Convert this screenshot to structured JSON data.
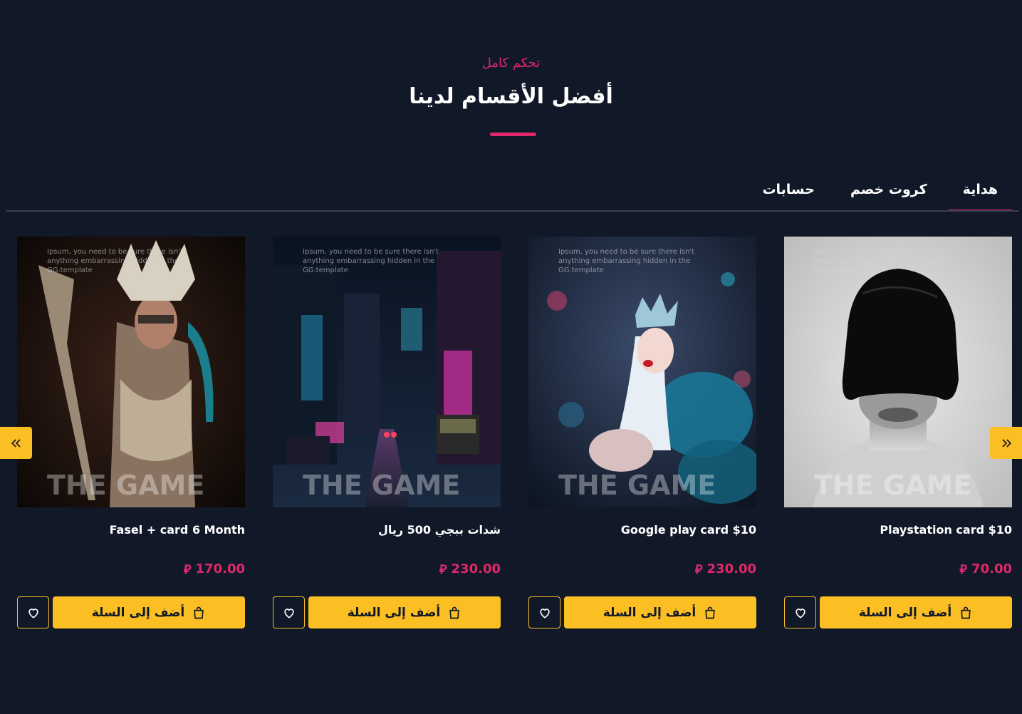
{
  "header": {
    "subtitle": "تحكم كامل",
    "title": "أفضل الأقسام لدينا"
  },
  "tabs": [
    {
      "label": "هداية",
      "active": true
    },
    {
      "label": "كروت خصم",
      "active": false
    },
    {
      "label": "حسابات",
      "active": false
    }
  ],
  "products": [
    {
      "name": "Playstation card $10",
      "price": "70.00",
      "add_label": "أضف إلى السلة",
      "image": "masked-face-portrait"
    },
    {
      "name": "Google play card $10",
      "price": "230.00",
      "add_label": "أضف إلى السلة",
      "image": "crowned-woman-portrait"
    },
    {
      "name": "شدات ببجي 500 ريال",
      "price": "230.00",
      "add_label": "أضف إلى السلة",
      "image": "night-city-street"
    },
    {
      "name": "Fasel + card 6 Month",
      "price": "170.00",
      "add_label": "أضف إلى السلة",
      "image": "tribal-warrior-woman"
    }
  ],
  "image_watermark": "Ipsum, you need to be sure there isn't anything embarrassing hidden in the GG.template",
  "image_overlay": "THE GAME",
  "currency_symbol": "⃁",
  "colors": {
    "background": "#111827",
    "accent": "#e0286b",
    "button": "#fbbf24"
  },
  "icons": {
    "slider_prev": "chevrons-left-icon",
    "slider_next": "chevrons-right-icon",
    "cart": "shopping-bag-icon",
    "wishlist": "heart-icon"
  }
}
